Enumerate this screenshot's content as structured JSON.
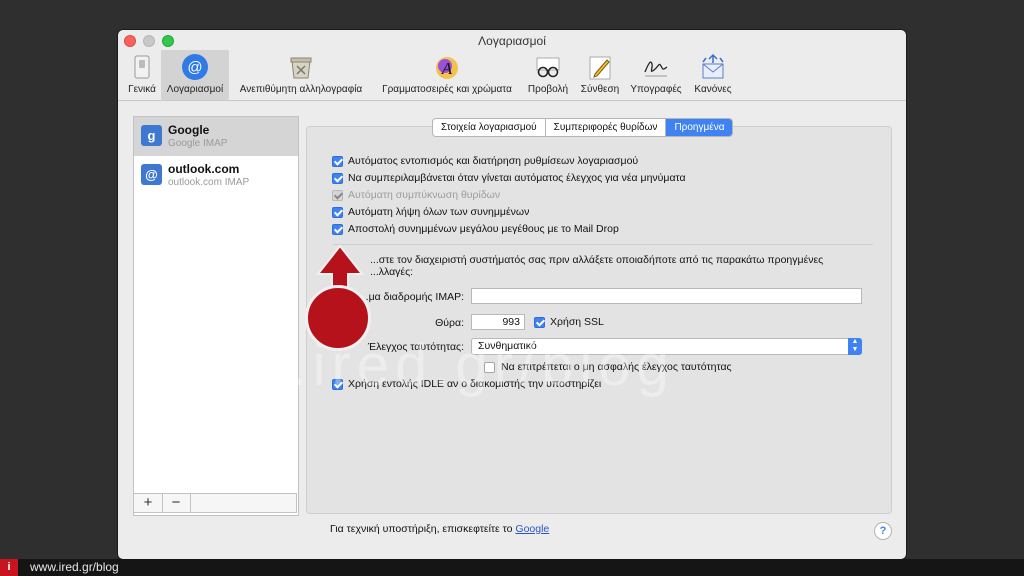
{
  "window": {
    "title": "Λογαριασμοί"
  },
  "toolbar": {
    "items": [
      {
        "label": "Γενικά",
        "icon": "switch-icon"
      },
      {
        "label": "Λογαριασμοί",
        "icon": "at-sign-icon",
        "selected": true
      },
      {
        "label": "Ανεπιθύμητη αλληλογραφία",
        "icon": "junk-mail-icon"
      },
      {
        "label": "Γραμματοσειρές και χρώματα",
        "icon": "font-color-icon"
      },
      {
        "label": "Προβολή",
        "icon": "glasses-icon"
      },
      {
        "label": "Σύνθεση",
        "icon": "compose-pencil-icon"
      },
      {
        "label": "Υπογραφές",
        "icon": "signature-icon"
      },
      {
        "label": "Κανόνες",
        "icon": "rules-envelope-icon"
      }
    ]
  },
  "accounts": [
    {
      "name": "Google",
      "type": "Google IMAP",
      "icon": "google-icon",
      "selected": true
    },
    {
      "name": "outlook.com",
      "type": "outlook.com IMAP",
      "icon": "at-sign-icon"
    }
  ],
  "list_footer": {
    "add": "+",
    "remove": "−"
  },
  "tabs": [
    {
      "label": "Στοιχεία λογαριασμού"
    },
    {
      "label": "Συμπεριφορές θυρίδων"
    },
    {
      "label": "Προηγμένα",
      "selected": true
    }
  ],
  "options": [
    {
      "label": "Αυτόματος εντοπισμός και διατήρηση ρυθμίσεων λογαριασμού",
      "checked": true,
      "disabled": false
    },
    {
      "label": "Να συμπεριλαμβάνεται όταν γίνεται αυτόματος έλεγχος για νέα μηνύματα",
      "checked": true,
      "disabled": false
    },
    {
      "label": "Αυτόματη συμπύκνωση θυρίδων",
      "checked": true,
      "disabled": true
    },
    {
      "label": "Αυτόματη λήψη όλων των συνημμένων",
      "checked": true,
      "disabled": false
    },
    {
      "label": "Αποστολή συνημμένων μεγάλου μεγέθους με το Mail Drop",
      "checked": true,
      "disabled": false
    }
  ],
  "advanced": {
    "notice_line1": "...στε τον διαχειριστή συστήματός σας πριν αλλάξετε οποιαδήποτε από τις παρακάτω προηγμένες",
    "notice_line2": "...λλαγές:",
    "imap_path_label": "...μα διαδρομής IMAP:",
    "imap_path_value": "",
    "port_label": "Θύρα:",
    "port_value": "993",
    "ssl_label": "Χρήση SSL",
    "ssl_checked": true,
    "auth_label": "Έλεγχος ταυτότητας:",
    "auth_value": "Συνθηματικό",
    "insecure_label": "Να επιτρέπεται ο μη ασφαλής έλεγχος ταυτότητας",
    "insecure_checked": false,
    "idle_label": "Χρήση εντολής IDLE αν ο διακομιστής την υποστηρίζει",
    "idle_checked": true
  },
  "footer": {
    "text": "Για τεχνική υποστήριξη, επισκεφτείτε το ",
    "link": "Google",
    "help": "?"
  },
  "overlay": {
    "watermark": "www.ired.gr/blog",
    "brand_logo": "i",
    "url": "www.ired.gr/blog"
  },
  "colors": {
    "accent": "#3f82f2",
    "marker_red": "#b5121b"
  }
}
